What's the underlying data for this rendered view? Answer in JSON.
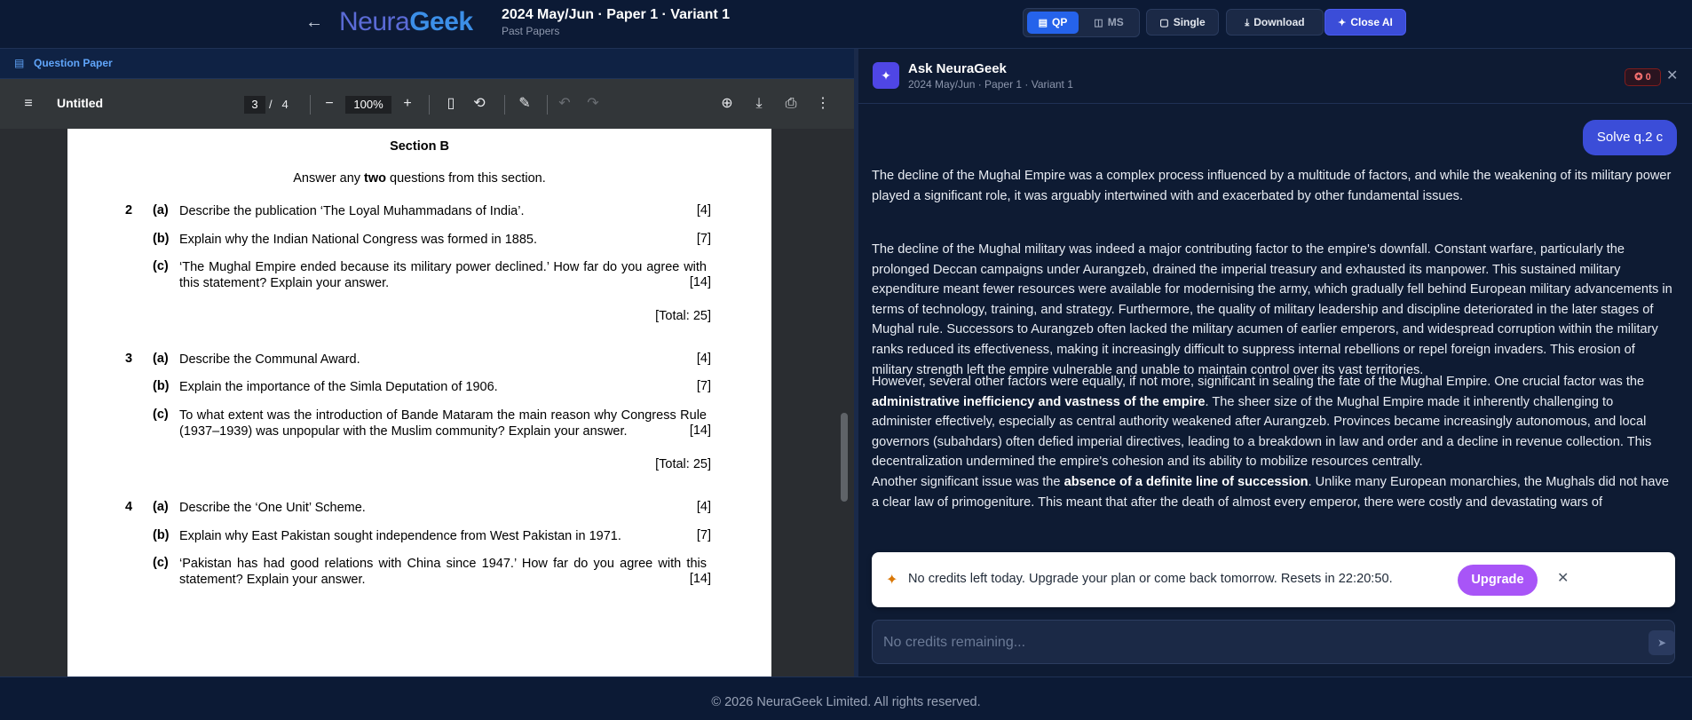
{
  "header": {
    "logo_part1": "Neura",
    "logo_part2": "Geek",
    "title": "2024 May/Jun · Paper 1 · Variant 1",
    "subtitle": "Past Papers",
    "qp_label": "QP",
    "ms_label": "MS",
    "single_label": "Single",
    "download_label": "Download",
    "close_ai_label": "Close AI"
  },
  "left": {
    "panel_label": "Question Paper",
    "doc_title": "Untitled",
    "page_current": "3",
    "page_sep": "/",
    "page_total": "4",
    "zoom": "100%"
  },
  "page": {
    "section": "Section B",
    "answer_pre": "Answer any ",
    "answer_bold": "two",
    "answer_post": " questions from this section.",
    "questions": [
      {
        "num": "2",
        "a": "Describe the publication ‘The Loyal Muhammadans of India’.",
        "am": "[4]",
        "b": "Explain why the Indian National Congress was formed in 1885.",
        "bm": "[7]",
        "c": "‘The Mughal Empire ended because its military power declined.’ How far do you agree with this statement? Explain your answer.",
        "cm": "[14]",
        "total": "[Total: 25]"
      },
      {
        "num": "3",
        "a": "Describe the Communal Award.",
        "am": "[4]",
        "b": "Explain the importance of the Simla Deputation of 1906.",
        "bm": "[7]",
        "c": "To what extent was the introduction of Bande Mataram the main reason why Congress Rule (1937–1939) was unpopular with the Muslim community? Explain your answer.",
        "cm": "[14]",
        "total": "[Total: 25]"
      },
      {
        "num": "4",
        "a": "Describe the ‘One Unit’ Scheme.",
        "am": "[4]",
        "b": "Explain why East Pakistan sought independence from West Pakistan in 1971.",
        "bm": "[7]",
        "c": "‘Pakistan has had good relations with China since 1947.’ How far do you agree with this statement? Explain your answer.",
        "cm": "[14]"
      }
    ],
    "labels": {
      "a": "(a)",
      "b": "(b)",
      "c": "(c)"
    }
  },
  "ai": {
    "title": "Ask NeuraGeek",
    "subtitle": "2024 May/Jun · Paper 1 · Variant 1",
    "credits": "0",
    "user_msg": "Solve q.2 c",
    "p1": "The decline of the Mughal Empire was a complex process influenced by a multitude of factors, and while the weakening of its military power played a significant role, it was arguably intertwined with and exacerbated by other fundamental issues.",
    "p2": "The decline of the Mughal military was indeed a major contributing factor to the empire's downfall. Constant warfare, particularly the prolonged Deccan campaigns under Aurangzeb, drained the imperial treasury and exhausted its manpower. This sustained military expenditure meant fewer resources were available for modernising the army, which gradually fell behind European military advancements in terms of technology, training, and strategy. Furthermore, the quality of military leadership and discipline deteriorated in the later stages of Mughal rule. Successors to Aurangzeb often lacked the military acumen of earlier emperors, and widespread corruption within the military ranks reduced its effectiveness, making it increasingly difficult to suppress internal rebellions or repel foreign invaders. This erosion of military strength left the empire vulnerable and unable to maintain control over its vast territories.",
    "p3a": "However, several other factors were equally, if not more, significant in sealing the fate of the Mughal Empire. One crucial factor was the ",
    "p3b": "administrative inefficiency and vastness of the empire",
    "p3c": ". The sheer size of the Mughal Empire made it inherently challenging to administer effectively, especially as central authority weakened after Aurangzeb. Provinces became increasingly autonomous, and local governors (subahdars) often defied imperial directives, leading to a breakdown in law and order and a decline in revenue collection. This decentralization undermined the empire's cohesion and its ability to mobilize resources centrally.",
    "p4a": "Another significant issue was the ",
    "p4b": "absence of a definite line of succession",
    "p4c": ". Unlike many European monarchies, the Mughals did not have a clear law of primogeniture. This meant that after the death of almost every emperor, there were costly and devastating wars of",
    "toast": "No credits left today. Upgrade your plan or come back tomorrow. Resets in 22:20:50.",
    "upgrade": "Upgrade",
    "placeholder": "No credits remaining..."
  },
  "footer": "© 2026 NeuraGeek Limited. All rights reserved."
}
